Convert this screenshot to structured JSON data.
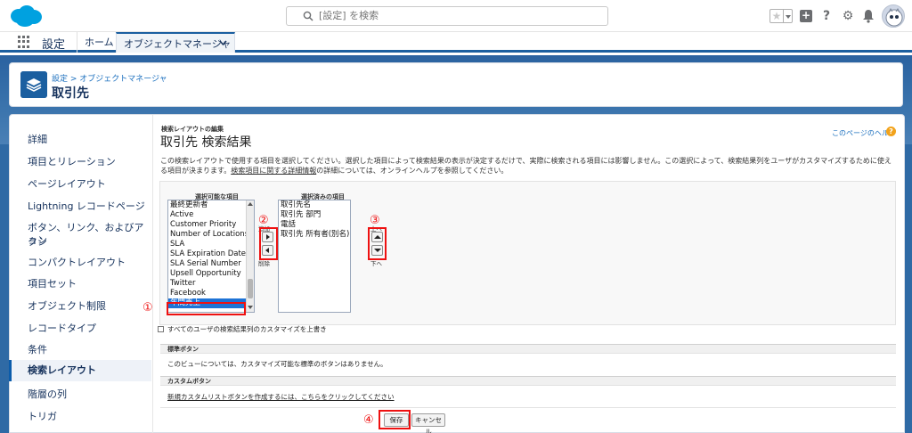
{
  "header": {
    "search_placeholder": "[設定] を検索",
    "icons": [
      "favorite-star-icon",
      "add-icon",
      "help-icon",
      "setup-gear-icon",
      "notification-bell-icon",
      "avatar"
    ]
  },
  "nav": {
    "app_name": "設定",
    "tabs": [
      {
        "label": "ホーム"
      },
      {
        "label": "オブジェクトマネージャ"
      }
    ]
  },
  "page_header": {
    "breadcrumb": "設定 > オブジェクトマネージャ",
    "title": "取引先"
  },
  "sidebar": {
    "items": [
      {
        "label": "詳細"
      },
      {
        "label": "項目とリレーション"
      },
      {
        "label": "ページレイアウト"
      },
      {
        "label": "Lightning レコードページ"
      },
      {
        "label": "ボタン、リンク、およびアクシ"
      },
      {
        "label": "ョン"
      },
      {
        "label": "コンパクトレイアウト"
      },
      {
        "label": "項目セット"
      },
      {
        "label": "オブジェクト制限"
      },
      {
        "label": "レコードタイプ"
      },
      {
        "label": "条件"
      },
      {
        "label": "検索レイアウト"
      },
      {
        "label": "階層の列"
      },
      {
        "label": "トリガ"
      }
    ],
    "active_label": "検索レイアウト"
  },
  "content": {
    "subtitle": "検索レイアウトの編集",
    "title": "取引先 検索結果",
    "help_link": "このページのヘルプ",
    "description_1": "この検索レイアウトで使用する項目を選択してください。選択した項目によって検索結果の表示が決定するだけで、実際に検索される項目には影響しません。この選択によって、検索結果列をユーザがカスタマイズするために使える項目が決まります。",
    "description_link": "検索項目に関する詳細情報",
    "description_2": "の詳細については、オンラインヘルプを参照してください。",
    "available_label": "選択可能な項目",
    "selected_label": "選択済みの項目",
    "available_items": [
      "最終更新者",
      "Active",
      "Customer Priority",
      "Number of Locations",
      "SLA",
      "SLA Expiration Date",
      "SLA Serial Number",
      "Upsell Opportunity",
      "Twitter",
      "Facebook",
      "年間売上"
    ],
    "available_selected": "年間売上",
    "selected_items": [
      "取引先名",
      "取引先 部門",
      "電話",
      "取引先 所有者(別名)"
    ],
    "add_label": "追加",
    "remove_label": "削除",
    "up_label": "上へ",
    "down_label": "下へ",
    "override_checkbox": "すべてのユーザの検索結果列のカスタマイズを上書き",
    "standard_buttons_head": "標準ボタン",
    "standard_buttons_text": "このビューについては、カスタマイズ可能な標準のボタンはありません。",
    "custom_buttons_head": "カスタムボタン",
    "custom_buttons_link": "新規カスタムリストボタンを作成するには、こちらをクリックしてください",
    "save_label": "保存",
    "cancel_label": "キャンセル"
  },
  "annotations": {
    "n1": "①",
    "n2": "②",
    "n3": "③",
    "n4": "④",
    "color": "#e11111"
  }
}
